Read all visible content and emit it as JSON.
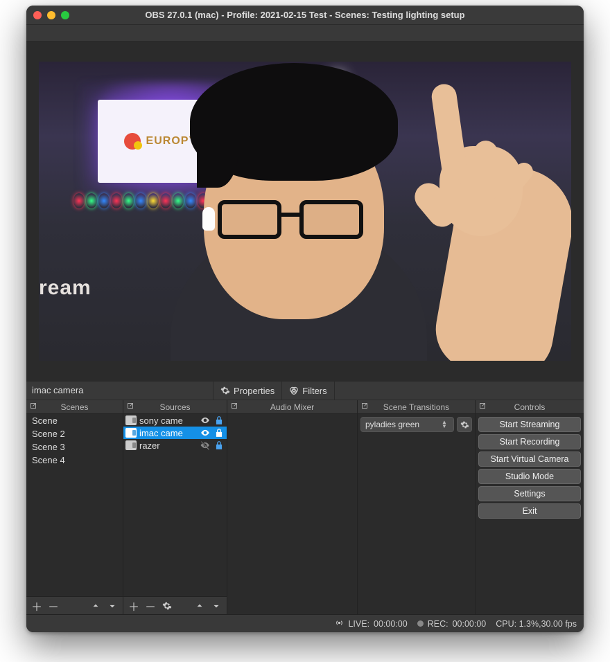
{
  "window": {
    "title": "OBS 27.0.1 (mac) - Profile: 2021-02-15 Test - Scenes: Testing lighting setup"
  },
  "selected_source_name": "imac camera",
  "toolbar": {
    "properties": "Properties",
    "filters": "Filters"
  },
  "preview": {
    "poster_text": "EUROPYTHON",
    "side_text": "ream"
  },
  "panels": {
    "scenes": {
      "title": "Scenes"
    },
    "sources": {
      "title": "Sources"
    },
    "audio_mixer": {
      "title": "Audio Mixer"
    },
    "transitions": {
      "title": "Scene Transitions"
    },
    "controls": {
      "title": "Controls"
    }
  },
  "scenes": [
    {
      "name": "Scene"
    },
    {
      "name": "Scene 2"
    },
    {
      "name": "Scene 3"
    },
    {
      "name": "Scene 4"
    }
  ],
  "sources": [
    {
      "name": "sony came",
      "visible": true,
      "locked": true,
      "selected": false
    },
    {
      "name": "imac came",
      "visible": true,
      "locked": true,
      "selected": true
    },
    {
      "name": "razer",
      "visible": false,
      "locked": true,
      "selected": false
    }
  ],
  "transitions": {
    "selected": "pyladies green"
  },
  "controls": {
    "start_streaming": "Start Streaming",
    "start_recording": "Start Recording",
    "start_virtual_camera": "Start Virtual Camera",
    "studio_mode": "Studio Mode",
    "settings": "Settings",
    "exit": "Exit"
  },
  "status": {
    "live_label": "LIVE:",
    "live_time": "00:00:00",
    "rec_label": "REC:",
    "rec_time": "00:00:00",
    "cpu": "CPU: 1.3%,30.00 fps"
  },
  "light_colors": [
    "#ff3355",
    "#33ff88",
    "#3388ff",
    "#ff3355",
    "#33ff88",
    "#3388ff",
    "#ffdd33",
    "#ff3355",
    "#33ff88",
    "#3388ff",
    "#ff3355",
    "#33ff88",
    "#3388ff",
    "#ffdd33",
    "#ff3355",
    "#33ff88",
    "#3388ff",
    "#ff3355",
    "#33ff88"
  ]
}
